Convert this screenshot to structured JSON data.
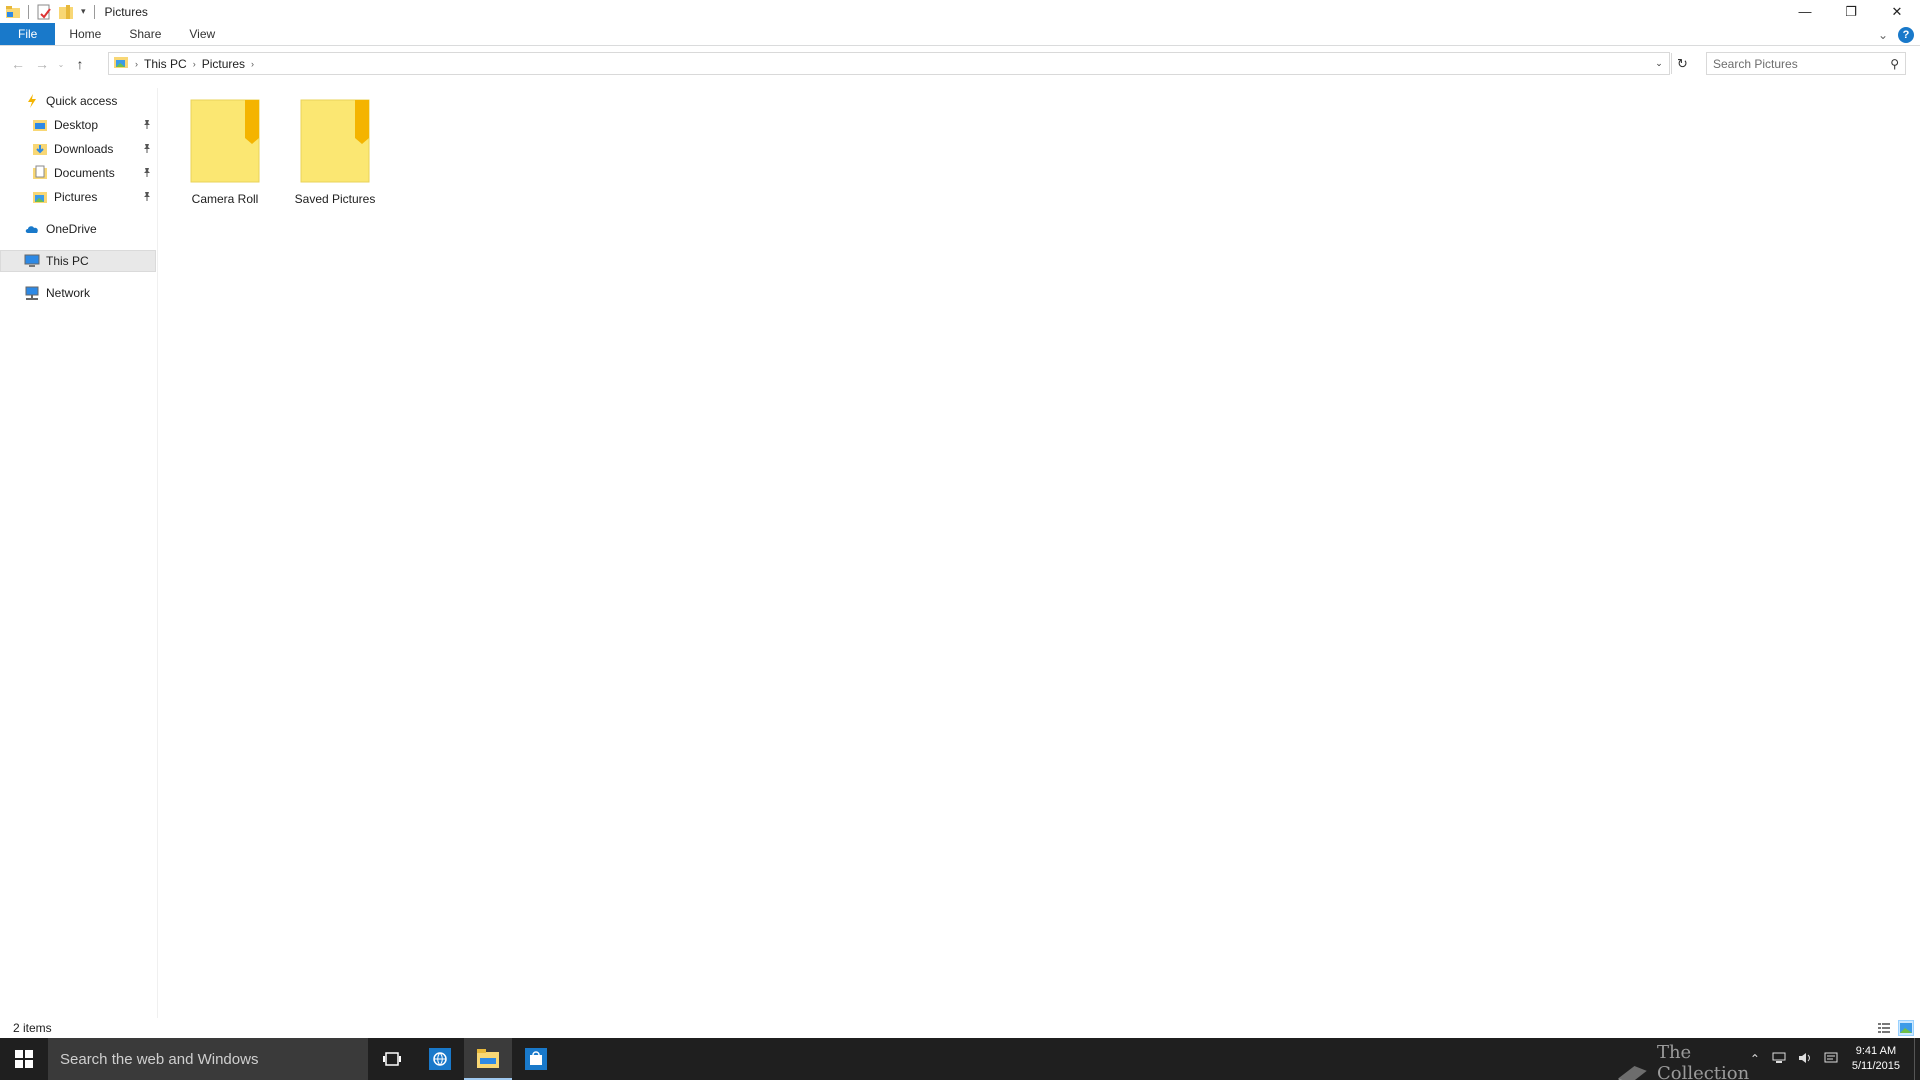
{
  "window": {
    "title": "Pictures",
    "controls": {
      "minimize_glyph": "—",
      "maximize_glyph": "❐",
      "close_glyph": "✕"
    },
    "qa_dropdown_glyph": "▾"
  },
  "ribbon": {
    "tabs": [
      {
        "label": "File"
      },
      {
        "label": "Home"
      },
      {
        "label": "Share"
      },
      {
        "label": "View"
      }
    ],
    "expand_glyph": "⌄",
    "help_glyph": "?"
  },
  "navigation": {
    "back_glyph": "←",
    "forward_glyph": "→",
    "recent_glyph": "⌄",
    "up_glyph": "↑",
    "breadcrumb": [
      {
        "label": "This PC"
      },
      {
        "label": "Pictures"
      }
    ],
    "crumb_separator": "›",
    "address_dropdown_glyph": "⌄",
    "refresh_glyph": "↻",
    "search_placeholder": "Search Pictures",
    "search_glyph": "⚲"
  },
  "nav_pane": {
    "quick_access": "Quick access",
    "pinned": [
      {
        "label": "Desktop",
        "icon": "desktop-icon"
      },
      {
        "label": "Downloads",
        "icon": "downloads-icon"
      },
      {
        "label": "Documents",
        "icon": "documents-icon"
      },
      {
        "label": "Pictures",
        "icon": "pictures-icon"
      }
    ],
    "pin_glyph": "📌",
    "onedrive": "OneDrive",
    "this_pc": "This PC",
    "network": "Network"
  },
  "content": {
    "items": [
      {
        "name": "Camera Roll",
        "icon": "folder-icon"
      },
      {
        "name": "Saved Pictures",
        "icon": "folder-icon"
      }
    ]
  },
  "status": {
    "item_count": "2 items"
  },
  "taskbar": {
    "search_text": "Search the web and Windows",
    "watermark_text": "The Collection Book",
    "time": "9:41 AM",
    "date": "5/11/2015",
    "tray_up_glyph": "⌃"
  },
  "colors": {
    "accent": "#1979ca",
    "folder_body": "#fbe772",
    "folder_tab": "#f4b400",
    "taskbar": "#1f1f1f"
  }
}
